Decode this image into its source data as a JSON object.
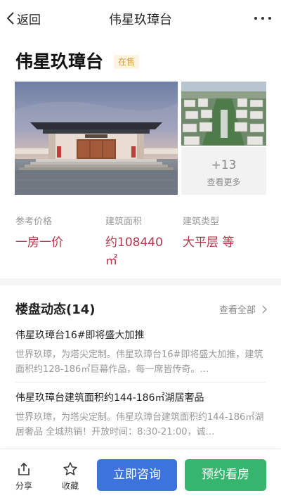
{
  "nav": {
    "back_label": "返回",
    "title": "伟星玖璋台"
  },
  "property": {
    "name": "伟星玖璋台",
    "status": "在售"
  },
  "gallery": {
    "more_count": "+13",
    "more_label": "查看更多"
  },
  "info": [
    {
      "label": "参考价格",
      "value": "一房一价"
    },
    {
      "label": "建筑面积",
      "value": "约108440",
      "unit": "㎡"
    },
    {
      "label": "建筑类型",
      "value": "大平层 等"
    }
  ],
  "news_section": {
    "title": "楼盘动态(14)",
    "view_all": "查看全部"
  },
  "news": [
    {
      "title": "伟星玖璋台16#即将盛大加推",
      "body": "世界玖璋，为塔尖定制。伟星玖璋台16#即将盛大加推，建筑面积约128-186㎡巨幕作品，每一席皆传奇。…"
    },
    {
      "title": "伟星玖璋台建筑面积约144-186㎡湖居奢品",
      "body": "世界玖璋，为塔尖定制。伟星玖璋台建筑面积约144-186㎡湖居奢品 全城热销！开放时间：8:30-21:00，诚…"
    }
  ],
  "bottom_bar": {
    "share_label": "分享",
    "favorite_label": "收藏",
    "consult_label": "立即咨询",
    "visit_label": "预约看房"
  },
  "colors": {
    "price_red": "#b7344a",
    "badge_bg": "#fdf3e2",
    "badge_text": "#d89a3c",
    "consult_blue": "#3d73dc",
    "visit_green": "#35b56e"
  },
  "icons": [
    "back-chevron-icon",
    "more-dots-icon",
    "chevron-right-icon",
    "share-icon",
    "star-icon"
  ]
}
